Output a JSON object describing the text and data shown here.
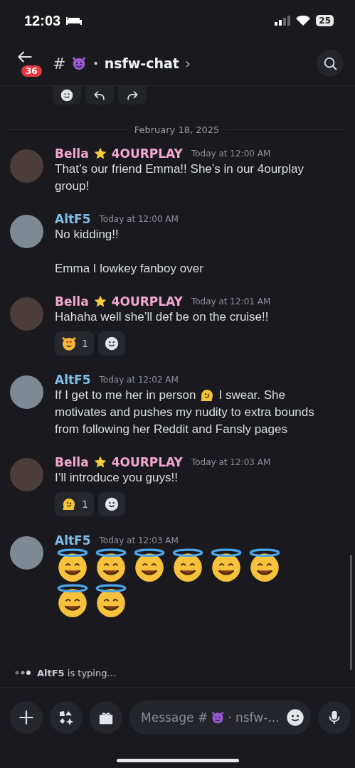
{
  "status_bar": {
    "time": "12:03",
    "battery": "25"
  },
  "header": {
    "unread_badge": "36",
    "hash": "#",
    "separator": "•",
    "channel": "nsfw-chat",
    "chevron": "›"
  },
  "date_divider": "February 18, 2025",
  "messages": [
    {
      "author": "Bella",
      "color": "#f2a7cf",
      "role": "4OURPLAY",
      "time": "Today at 12:00 AM",
      "body": [
        {
          "kind": "text",
          "text": "That’s our friend Emma!! She’s in our 4ourplay group!"
        }
      ]
    },
    {
      "author": "AltF5",
      "color": "#82bde6",
      "time": "Today at 12:00 AM",
      "body": [
        {
          "kind": "text",
          "text": "No kidding!!"
        },
        {
          "kind": "break"
        },
        {
          "kind": "text",
          "text": "Emma I lowkey fanboy over"
        }
      ]
    },
    {
      "author": "Bella",
      "color": "#f2a7cf",
      "role": "4OURPLAY",
      "time": "Today at 12:01 AM",
      "body": [
        {
          "kind": "text",
          "text": "Hahaha well she’ll def be on the cruise!!"
        }
      ],
      "reactions": [
        {
          "kind": "heart-eyes-cat",
          "count": "1"
        }
      ]
    },
    {
      "author": "AltF5",
      "color": "#82bde6",
      "time": "Today at 12:02 AM",
      "body": [
        {
          "kind": "text",
          "text": "If I get to me her in person"
        },
        {
          "kind": "melting"
        },
        {
          "kind": "text",
          "text": "I swear. She"
        },
        {
          "kind": "newline"
        },
        {
          "kind": "text",
          "text": "motivates and pushes my nudity to extra bounds"
        },
        {
          "kind": "newline"
        },
        {
          "kind": "text",
          "text": "from following her Reddit and Fansly pages"
        }
      ]
    },
    {
      "author": "Bella",
      "color": "#f2a7cf",
      "role": "4OURPLAY",
      "time": "Today at 12:03 AM",
      "body": [
        {
          "kind": "text",
          "text": "I’ll introduce you guys!!"
        }
      ],
      "reactions": [
        {
          "kind": "melting",
          "count": "1"
        }
      ]
    },
    {
      "author": "AltF5",
      "color": "#82bde6",
      "time": "Today at 12:03 AM",
      "body": [
        {
          "kind": "halo"
        },
        {
          "kind": "halo"
        },
        {
          "kind": "halo"
        },
        {
          "kind": "halo"
        },
        {
          "kind": "halo"
        },
        {
          "kind": "halo"
        },
        {
          "kind": "halo"
        },
        {
          "kind": "halo"
        }
      ]
    }
  ],
  "typing": {
    "name": "AltF5",
    "text": "is typing..."
  },
  "composer": {
    "placeholder": {
      "before": "Message #",
      "after": "· nsfw-..."
    }
  }
}
